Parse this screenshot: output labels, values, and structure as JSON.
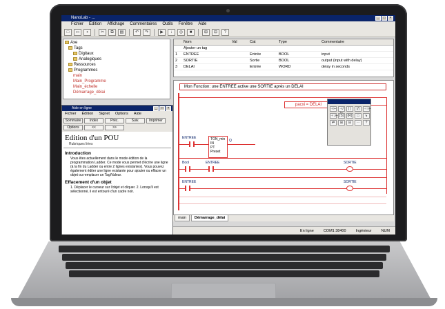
{
  "app": {
    "title": "NanoLab - ...",
    "menu": [
      "Fichier",
      "Édition",
      "Affichage",
      "Commentaires",
      "Outils",
      "Fenêtre",
      "Aide"
    ]
  },
  "tree": {
    "items": [
      {
        "label": "Axe",
        "level": 0
      },
      {
        "label": "Tags",
        "level": 1
      },
      {
        "label": "Digitaux",
        "level": 2
      },
      {
        "label": "Analogiques",
        "level": 2
      },
      {
        "label": "Ressources",
        "level": 1
      },
      {
        "label": "Programmes",
        "level": 1
      },
      {
        "label": "main",
        "level": 2
      },
      {
        "label": "Main_Programme",
        "level": 2
      },
      {
        "label": "Main_échelle",
        "level": 2
      },
      {
        "label": "Démarrage_délai",
        "level": 2
      }
    ]
  },
  "variables": {
    "headers": [
      "",
      "Nom",
      "Val",
      "Cat",
      "Type",
      "Commentaire"
    ],
    "rows": [
      [
        "",
        "Ajouter un tag",
        "",
        "",
        "",
        ""
      ],
      [
        "1",
        "ENTREE",
        "",
        "Entrée",
        "BOOL",
        "input"
      ],
      [
        "2",
        "SORTIE",
        "",
        "Sortie",
        "BOOL",
        "output (input with delay)"
      ],
      [
        "3",
        "DELAI",
        "",
        "Entrée",
        "WORD",
        "delay in seconds"
      ]
    ]
  },
  "ladder": {
    "rung_title": "Mon Fonction: une ENTREE active une SORTIE après un DELAI",
    "assignment": "pacxi = DELAI",
    "labels": {
      "entree1": "ENTREE",
      "fb_name": "TON_min",
      "fb_in": "IN",
      "fb_pt": "PT",
      "fb_preset": "Preset",
      "q": "Q",
      "bool_label": "Bool",
      "entree2": "ENTREE",
      "sortie1": "SORTIE",
      "entree3": "ENTREE",
      "sortie2": "SORTIE"
    },
    "palette_cells": [
      "⊣⊢",
      "⊣/⊢",
      "( )",
      "(/)",
      "⊣↑⊢",
      "⊣↓⊢",
      "(S)",
      "(R)",
      "▭",
      "↳",
      "⇄",
      "⊞",
      "⊟",
      "⋯",
      "?"
    ]
  },
  "editor_tabs": [
    "main",
    "Démarrage_délai"
  ],
  "status": {
    "online": "En ligne",
    "port": "COM1 38400",
    "mode": "Ingénieur",
    "numlock": "NUM"
  },
  "help": {
    "title": "Aide en ligne",
    "menu": [
      "Fichier",
      "Édition",
      "Signet",
      "Options",
      "Aide"
    ],
    "buttons": [
      "Sommaire",
      "Index",
      "Préc.",
      "Suiv.",
      "Imprimer",
      "Options",
      "<<",
      ">>"
    ],
    "heading": "Edition d'un POU",
    "link": "Rubriques liées",
    "sections": [
      {
        "title": "Introduction",
        "text": "Vous êtes actuellement dans le mode édition de la programmation Ladder. Ce mode vous permet d'écrire une ligne (à la fin du Ladder ou entre 2 lignes existantes). Vous pouvez également éditer une ligne existante pour ajouter ou effacer un objet ou remplacer un Tag/Valeur."
      },
      {
        "title": "Effacement d'un objet",
        "text": "1. Déplacer le curseur sur l'objet et cliquer. 2. Lorsqu'il est sélectionné, il est entouré d'un cadre noir."
      }
    ]
  },
  "colors": {
    "titlebar": "#0a246a",
    "ladder_red": "#d33333",
    "laptop_bezel": "#1c1c1e",
    "laptop_body": "#c9c9cb"
  }
}
